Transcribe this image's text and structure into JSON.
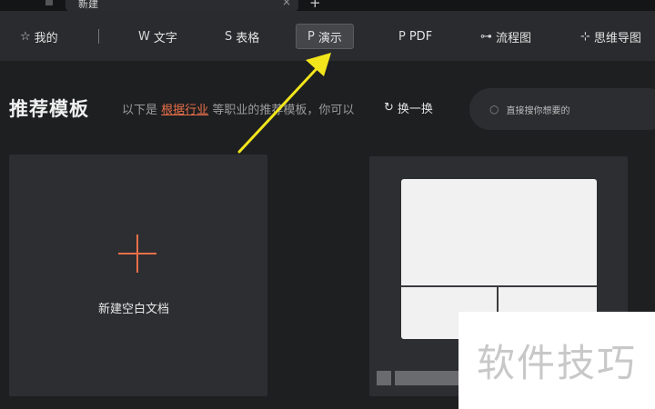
{
  "tab": {
    "title": "新建",
    "close": "×",
    "add": "+"
  },
  "toolbar": {
    "items": [
      {
        "label": "我的",
        "icon": "☆"
      },
      {
        "label": "文字",
        "icon": "W"
      },
      {
        "label": "表格",
        "icon": "S"
      },
      {
        "label": "演示",
        "icon": "P"
      },
      {
        "label": "PDF",
        "icon": "P"
      },
      {
        "label": "流程图",
        "icon": "⊶"
      },
      {
        "label": "思维导图",
        "icon": "⊹"
      }
    ]
  },
  "heading": {
    "title": "推荐模板",
    "subtitle_prefix": "以下是",
    "subtitle_link": "根据行业",
    "subtitle_suffix": "等职业的推荐模板，你可以",
    "refresh": "换一换"
  },
  "search": {
    "placeholder": "直接搜你想要的"
  },
  "cards": {
    "blank_label": "新建空白文档"
  },
  "watermark": "软件技巧",
  "colors": {
    "accent": "#e8704a",
    "arrow": "#f2e51c"
  }
}
